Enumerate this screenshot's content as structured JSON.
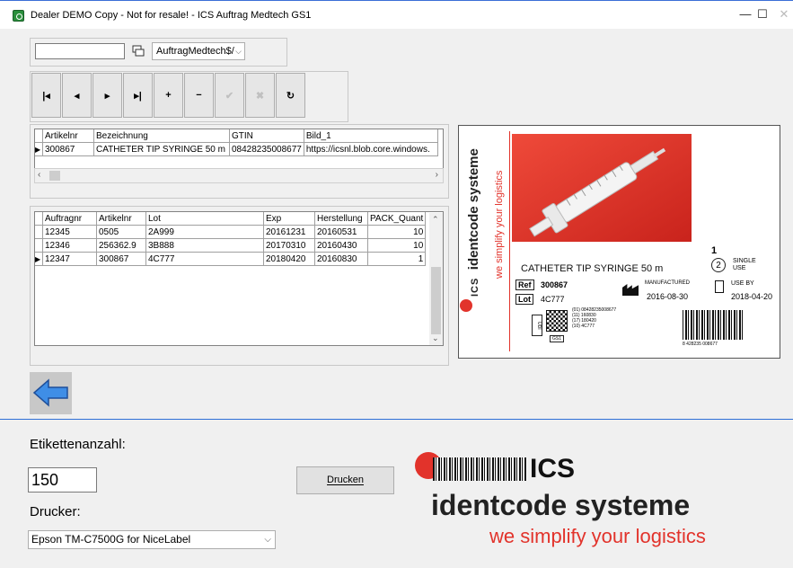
{
  "window": {
    "title": "Dealer DEMO Copy - Not for resale! - ICS Auftrag Medtech GS1",
    "minimize": "—",
    "maximize": "☐",
    "close": "✕"
  },
  "toolbar": {
    "search_value": "",
    "database_select": "AuftragMedtech$/"
  },
  "navigator": {
    "buttons": [
      {
        "name": "first-record-button",
        "glyph": "|◂"
      },
      {
        "name": "prior-record-button",
        "glyph": "◂"
      },
      {
        "name": "next-record-button",
        "glyph": "▸"
      },
      {
        "name": "last-record-button",
        "glyph": "▸|"
      },
      {
        "name": "insert-record-button",
        "glyph": "+"
      },
      {
        "name": "delete-record-button",
        "glyph": "−"
      },
      {
        "name": "post-record-button",
        "glyph": "✔"
      },
      {
        "name": "cancel-record-button",
        "glyph": "✖"
      },
      {
        "name": "refresh-button",
        "glyph": "↻"
      }
    ]
  },
  "articles_grid": {
    "headers": [
      "Artikelnr",
      "Bezeichnung",
      "GTIN",
      "Bild_1"
    ],
    "rows": [
      [
        "300867",
        "CATHETER TIP SYRINGE 50 m",
        "08428235008677",
        "https://icsnl.blob.core.windows."
      ]
    ]
  },
  "orders_grid": {
    "headers": [
      "Auftragnr",
      "Artikelnr",
      "Lot",
      "Exp",
      "Herstellung",
      "PACK_Quant"
    ],
    "rows": [
      [
        "12345",
        "0505",
        "2A999",
        "20161231",
        "20160531",
        "10"
      ],
      [
        "12346",
        "256362.9",
        "3B888",
        "20170310",
        "20160430",
        "10"
      ],
      [
        "12347",
        "300867",
        "4C777",
        "20180420",
        "20160830",
        "1"
      ]
    ]
  },
  "label_preview": {
    "brand_vertical": "identcode systeme",
    "tagline_vertical": "we simplify your logistics",
    "ics_vertical": "ICS",
    "quantity": "1",
    "single_use": "SINGLE USE",
    "product_name": "CATHETER TIP SYRINGE 50 m",
    "ref_label": "Ref",
    "ref_value": "300867",
    "lot_label": "Lot",
    "lot_value": "4C777",
    "manufactured_label": "MANUFACTURED",
    "manufactured_date": "2016-08-30",
    "use_by_label": "USE BY",
    "use_by_date": "2018-04-20",
    "udi_label": "UDI",
    "gs1_label": "GS1",
    "hri_lines": [
      "(01) 08428235008677",
      "(11) 160830",
      "(17) 180420",
      "(10) 4C777"
    ],
    "ean_text": "8 428235 008677"
  },
  "print_panel": {
    "etiketten_label": "Etikettenanzahl:",
    "etiketten_value": "150",
    "drucker_label": "Drucker:",
    "printer_value": "Epson TM-C7500G for NiceLabel",
    "print_button": "Drucken"
  },
  "logo": {
    "ics": "ICS",
    "company": "identcode systeme",
    "tagline": "we simplify your logistics"
  },
  "colors": {
    "brand_red": "#e2332b",
    "accent_blue": "#2f6fd6",
    "back_arrow": "#3f8ee6"
  }
}
